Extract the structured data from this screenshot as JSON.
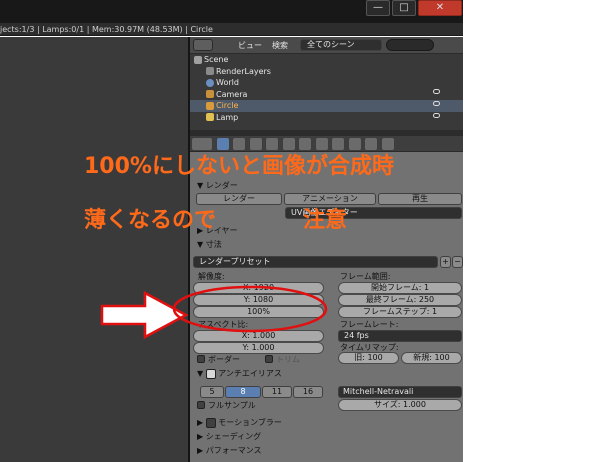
{
  "infobar": {
    "text": "jects:1/3 | Lamps:0/1 | Mem:30.97M (48.53M) | Circle"
  },
  "window": {
    "min": "—",
    "max": "□",
    "close": "✕"
  },
  "outliner": {
    "view_menu": "ビュー",
    "search_menu": "検索",
    "scene_select": "全てのシーン",
    "rows": [
      "Scene",
      "RenderLayers",
      "World",
      "Camera",
      "Circle",
      "Lamp"
    ]
  },
  "render": {
    "panel_render": "レンダー",
    "render_btn": "レンダー",
    "animation_btn": "アニメーション",
    "play_btn": "再生",
    "display_select": "UV画像エディター",
    "panel_layer": "レイヤー",
    "panel_dimensions": "寸法",
    "preset": "レンダープリセット",
    "resolution_label": "解像度:",
    "res_x": "X: 1920",
    "res_y": "Y: 1080",
    "res_pct": "100%",
    "aspect_label": "アスペクト比:",
    "aspect_x": "X: 1.000",
    "aspect_y": "Y: 1.000",
    "border": "ボーダー",
    "crop": "トリム",
    "frame_range_label": "フレーム範囲:",
    "frame_start": "開始フレーム: 1",
    "frame_end": "最終フレーム: 250",
    "frame_step": "フレームステップ: 1",
    "frame_rate_label": "フレームレート:",
    "fps": "24 fps",
    "time_remap_label": "タイムリマップ:",
    "remap_old": "旧: 100",
    "remap_new": "新規: 100",
    "panel_aa": "アンチエイリアス",
    "aa_samples": [
      "5",
      "8",
      "11",
      "16"
    ],
    "aa_filter": "Mitchell-Netravali",
    "full_sample": "フルサンプル",
    "size": "サイズ: 1.000",
    "panel_motion_blur": "モーションブラー",
    "panel_shading": "シェーディング",
    "panel_performance": "パフォーマンス"
  },
  "annotation": {
    "line1": "100%にしないと画像が合成時",
    "line2": "薄くなるので",
    "line3": "注意",
    "color": "#ff6a1a",
    "ellipse_color": "#e01010",
    "arrow_color": "#e01010"
  }
}
